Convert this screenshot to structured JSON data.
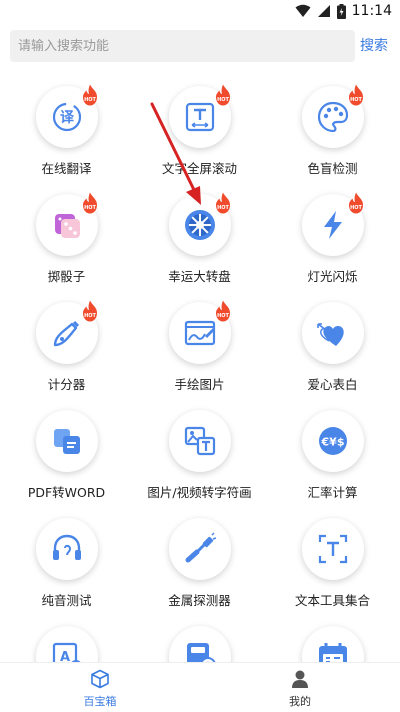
{
  "status": {
    "time": "11:14"
  },
  "search": {
    "placeholder": "请输入搜索功能",
    "button": "搜索"
  },
  "tools": [
    {
      "label": "在线翻译",
      "icon": "translate-icon",
      "hot": true
    },
    {
      "label": "文字全屏滚动",
      "icon": "text-scroll-icon",
      "hot": true
    },
    {
      "label": "色盲检测",
      "icon": "palette-icon",
      "hot": true
    },
    {
      "label": "掷骰子",
      "icon": "dice-icon",
      "hot": true
    },
    {
      "label": "幸运大转盘",
      "icon": "wheel-icon",
      "hot": true
    },
    {
      "label": "灯光闪烁",
      "icon": "flash-icon",
      "hot": true
    },
    {
      "label": "计分器",
      "icon": "score-icon",
      "hot": true
    },
    {
      "label": "手绘图片",
      "icon": "drawing-icon",
      "hot": true
    },
    {
      "label": "爱心表白",
      "icon": "heart-icon",
      "hot": false
    },
    {
      "label": "PDF转WORD",
      "icon": "pdf-icon",
      "hot": false
    },
    {
      "label": "图片/视频转字符画",
      "icon": "image-text-icon",
      "hot": false
    },
    {
      "label": "汇率计算",
      "icon": "currency-icon",
      "hot": false
    },
    {
      "label": "纯音测试",
      "icon": "headphone-icon",
      "hot": false
    },
    {
      "label": "金属探测器",
      "icon": "metal-detector-icon",
      "hot": false
    },
    {
      "label": "文本工具集合",
      "icon": "text-tools-icon",
      "hot": false
    },
    {
      "label": "",
      "icon": "image-edit-icon",
      "hot": false
    },
    {
      "label": "",
      "icon": "calculator-icon",
      "hot": false
    },
    {
      "label": "",
      "icon": "calendar-icon",
      "hot": false
    }
  ],
  "nav": {
    "home": "百宝箱",
    "mine": "我的"
  },
  "colors": {
    "accent": "#3a7be0",
    "icon_blue": "#4a86e8",
    "hot_red": "#f04b2c",
    "arrow": "#d62222"
  }
}
